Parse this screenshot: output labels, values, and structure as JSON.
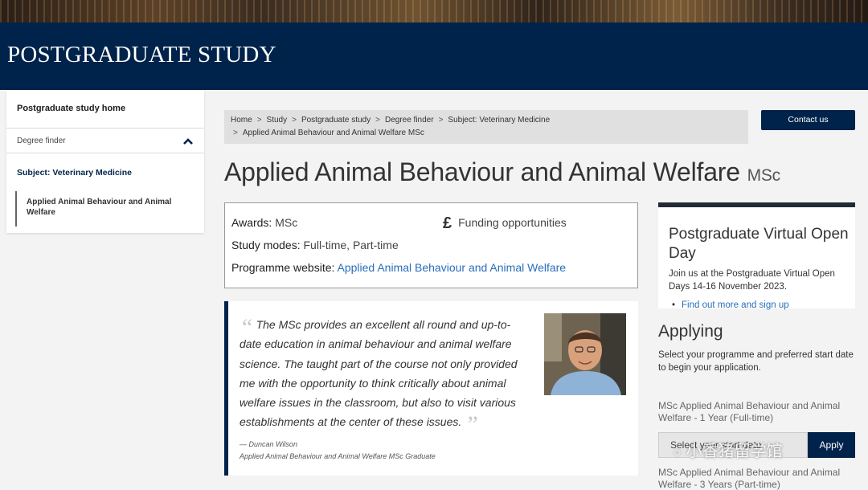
{
  "header": {
    "title": "POSTGRADUATE STUDY"
  },
  "sidebar": {
    "home": "Postgraduate study home",
    "finder": "Degree finder",
    "subject": "Subject: Veterinary Medicine",
    "current": "Applied Animal Behaviour and Animal Welfare"
  },
  "breadcrumb": {
    "items": [
      "Home",
      "Study",
      "Postgraduate study",
      "Degree finder",
      "Subject: Veterinary Medicine"
    ],
    "current": "Applied Animal Behaviour and Animal Welfare MSc",
    "separator": ">"
  },
  "contact": {
    "label": "Contact us"
  },
  "programme": {
    "title": "Applied Animal Behaviour and Animal Welfare",
    "award_suffix": "MSc"
  },
  "facts": {
    "awards_label": "Awards:",
    "awards_value": "MSc",
    "modes_label": "Study modes:",
    "modes_value": "Full-time, Part-time",
    "website_label": "Programme website:",
    "website_link": "Applied Animal Behaviour and Animal Welfare",
    "funding_label": "Funding opportunities",
    "funding_icon": "£"
  },
  "quote": {
    "text": "The MSc provides an excellent all round and up-to-date education in animal behaviour and animal welfare science. The taught part of the course not only provided me with the opportunity to think critically about animal welfare issues in the classroom, but also to visit various establishments at the center of these issues.",
    "author": "— Duncan Wilson",
    "role": "Applied Animal Behaviour and Animal Welfare MSc Graduate"
  },
  "openday": {
    "title": "Postgraduate Virtual Open Day",
    "text": "Join us at the Postgraduate Virtual Open Days 14-16 November 2023.",
    "link": "Find out more and sign up"
  },
  "applying": {
    "title": "Applying",
    "text": "Select your programme and preferred start date to begin your application.",
    "programme_1": "MSc Applied Animal Behaviour and Animal Welfare - 1 Year (Full-time)",
    "select_placeholder": "Select your start date",
    "apply_label": "Apply",
    "programme_2": "MSc Applied Animal Behaviour and Animal Welfare - 3 Years (Part-time)"
  },
  "watermark": {
    "text": "小香猪留学馆"
  },
  "colors": {
    "navy": "#00234b",
    "link": "#2a6ebb"
  }
}
